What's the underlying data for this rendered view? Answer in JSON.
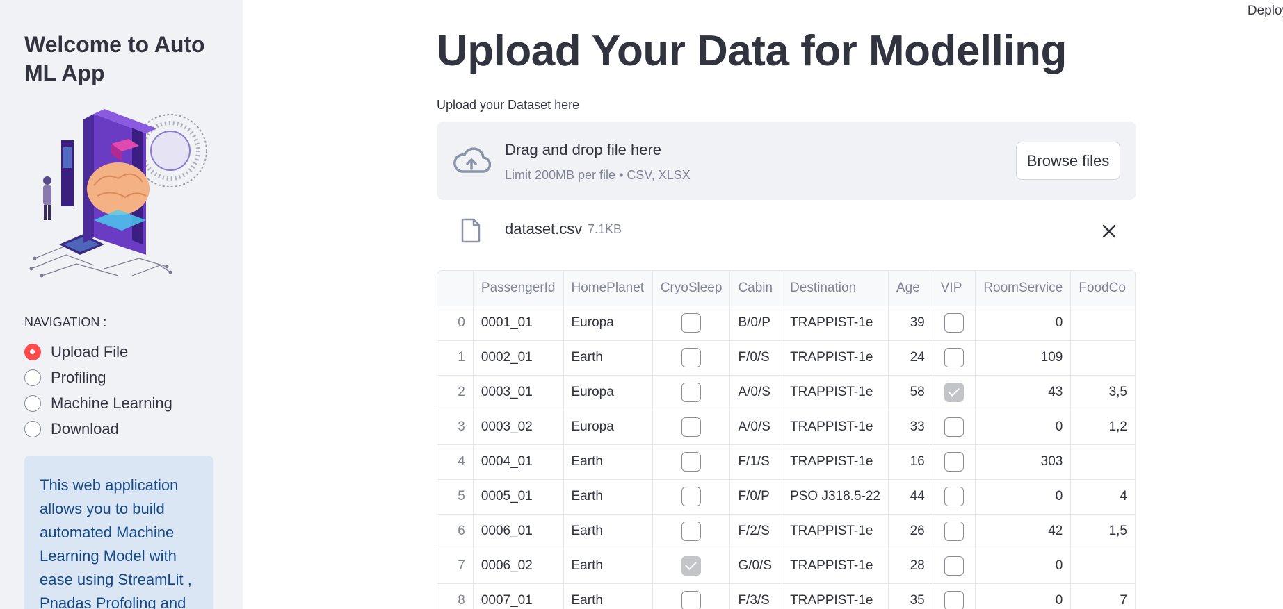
{
  "sidebar": {
    "title": "Welcome to Auto ML App",
    "illustration": "ai-brain-3d-printer-illustration",
    "nav_label": "NAVIGATION :",
    "nav_options": [
      {
        "label": "Upload File",
        "selected": true
      },
      {
        "label": "Profiling",
        "selected": false
      },
      {
        "label": "Machine Learning",
        "selected": false
      },
      {
        "label": "Download",
        "selected": false
      }
    ],
    "info_text": "This web application allows you to build automated Machine Learning Model with ease using StreamLit , Pnadas Profoling and"
  },
  "header": {
    "deploy_label": "Deploy"
  },
  "main": {
    "title": "Upload Your Data for Modelling",
    "upload_label": "Upload your Dataset here",
    "dropzone": {
      "icon": "cloud-upload-icon",
      "title": "Drag and drop file here",
      "subtitle": "Limit 200MB per file • CSV, XLSX",
      "browse_label": "Browse files"
    },
    "uploaded_file": {
      "icon": "file-icon",
      "name": "dataset.csv",
      "size": "7.1KB"
    }
  },
  "table": {
    "columns": [
      "",
      "PassengerId",
      "HomePlanet",
      "CryoSleep",
      "Cabin",
      "Destination",
      "Age",
      "VIP",
      "RoomService",
      "FoodCo"
    ],
    "rows": [
      {
        "idx": "0",
        "PassengerId": "0001_01",
        "HomePlanet": "Europa",
        "CryoSleep": false,
        "Cabin": "B/0/P",
        "Destination": "TRAPPIST-1e",
        "Age": "39",
        "VIP": false,
        "RoomService": "0",
        "FoodCourt": ""
      },
      {
        "idx": "1",
        "PassengerId": "0002_01",
        "HomePlanet": "Earth",
        "CryoSleep": false,
        "Cabin": "F/0/S",
        "Destination": "TRAPPIST-1e",
        "Age": "24",
        "VIP": false,
        "RoomService": "109",
        "FoodCourt": ""
      },
      {
        "idx": "2",
        "PassengerId": "0003_01",
        "HomePlanet": "Europa",
        "CryoSleep": false,
        "Cabin": "A/0/S",
        "Destination": "TRAPPIST-1e",
        "Age": "58",
        "VIP": true,
        "RoomService": "43",
        "FoodCourt": "3,5"
      },
      {
        "idx": "3",
        "PassengerId": "0003_02",
        "HomePlanet": "Europa",
        "CryoSleep": false,
        "Cabin": "A/0/S",
        "Destination": "TRAPPIST-1e",
        "Age": "33",
        "VIP": false,
        "RoomService": "0",
        "FoodCourt": "1,2"
      },
      {
        "idx": "4",
        "PassengerId": "0004_01",
        "HomePlanet": "Earth",
        "CryoSleep": false,
        "Cabin": "F/1/S",
        "Destination": "TRAPPIST-1e",
        "Age": "16",
        "VIP": false,
        "RoomService": "303",
        "FoodCourt": ""
      },
      {
        "idx": "5",
        "PassengerId": "0005_01",
        "HomePlanet": "Earth",
        "CryoSleep": false,
        "Cabin": "F/0/P",
        "Destination": "PSO J318.5-22",
        "Age": "44",
        "VIP": false,
        "RoomService": "0",
        "FoodCourt": "4"
      },
      {
        "idx": "6",
        "PassengerId": "0006_01",
        "HomePlanet": "Earth",
        "CryoSleep": false,
        "Cabin": "F/2/S",
        "Destination": "TRAPPIST-1e",
        "Age": "26",
        "VIP": false,
        "RoomService": "42",
        "FoodCourt": "1,5"
      },
      {
        "idx": "7",
        "PassengerId": "0006_02",
        "HomePlanet": "Earth",
        "CryoSleep": true,
        "Cabin": "G/0/S",
        "Destination": "TRAPPIST-1e",
        "Age": "28",
        "VIP": false,
        "RoomService": "0",
        "FoodCourt": ""
      },
      {
        "idx": "8",
        "PassengerId": "0007_01",
        "HomePlanet": "Earth",
        "CryoSleep": false,
        "Cabin": "F/3/S",
        "Destination": "TRAPPIST-1e",
        "Age": "35",
        "VIP": false,
        "RoomService": "0",
        "FoodCourt": "7"
      }
    ]
  },
  "colors": {
    "accent": "#ff4b4b",
    "sidebar_bg": "#f0f2f6",
    "info_bg": "#dbe6f4",
    "info_text": "#154a8a",
    "text": "#31333f",
    "muted": "#808495",
    "illustration_purple": "#4b2a9b",
    "illustration_brain": "#f4b183"
  }
}
